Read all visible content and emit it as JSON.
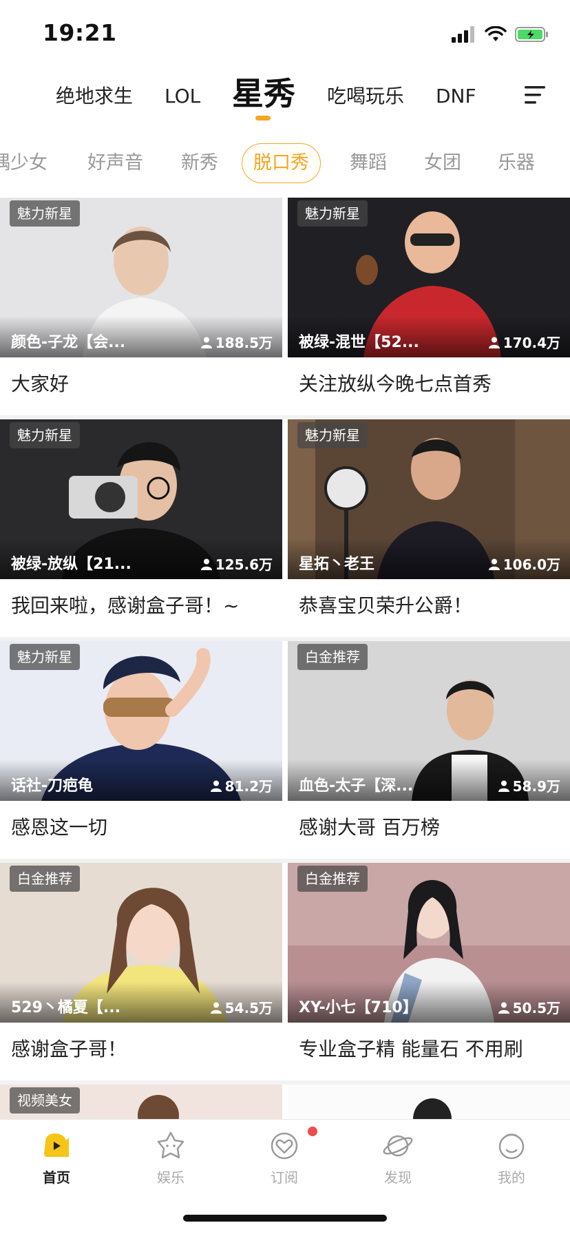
{
  "status_bar": {
    "time": "19:21"
  },
  "channels": {
    "items": [
      "绝地求生",
      "LOL",
      "星秀",
      "吃喝玩乐",
      "DNF"
    ],
    "active": "星秀"
  },
  "sub_tabs": {
    "items": [
      "偶少女",
      "好声音",
      "新秀",
      "脱口秀",
      "舞蹈",
      "女团",
      "乐器"
    ],
    "active": "脱口秀"
  },
  "cards": [
    {
      "badge": "魅力新星",
      "anchor": "颜色-子龙【会...",
      "viewers": "188.5万",
      "title": "大家好"
    },
    {
      "badge": "魅力新星",
      "anchor": "被绿-混世【52...",
      "viewers": "170.4万",
      "title": "关注放纵今晚七点首秀"
    },
    {
      "badge": "魅力新星",
      "anchor": "被绿-放纵【21...",
      "viewers": "125.6万",
      "title": "我回来啦，感谢盒子哥！~"
    },
    {
      "badge": "魅力新星",
      "anchor": "星拓丶老王",
      "viewers": "106.0万",
      "title": "恭喜宝贝荣升公爵！"
    },
    {
      "badge": "魅力新星",
      "anchor": "话社-刀疤龟",
      "viewers": "81.2万",
      "title": "感恩这一切"
    },
    {
      "badge": "白金推荐",
      "anchor": "血色-太子【深...",
      "viewers": "58.9万",
      "title": "感谢大哥 百万榜"
    },
    {
      "badge": "白金推荐",
      "anchor": "529丶橘夏【...",
      "viewers": "54.5万",
      "title": "感谢盒子哥！"
    },
    {
      "badge": "白金推荐",
      "anchor": "XY-小七【710】",
      "viewers": "50.5万",
      "title": "专业盒子精 能量石  不用刷"
    },
    {
      "badge": "视频美女",
      "anchor": "",
      "viewers": "",
      "title": ""
    }
  ],
  "tab_bar": {
    "items": [
      {
        "label": "首页",
        "icon": "home-icon"
      },
      {
        "label": "娱乐",
        "icon": "entertainment-icon"
      },
      {
        "label": "订阅",
        "icon": "subscribe-icon"
      },
      {
        "label": "发现",
        "icon": "discover-icon"
      },
      {
        "label": "我的",
        "icon": "profile-icon"
      }
    ],
    "active": "首页"
  },
  "colors": {
    "accent": "#f5a623",
    "notification": "#f04b4b",
    "battery": "#4cd964"
  }
}
